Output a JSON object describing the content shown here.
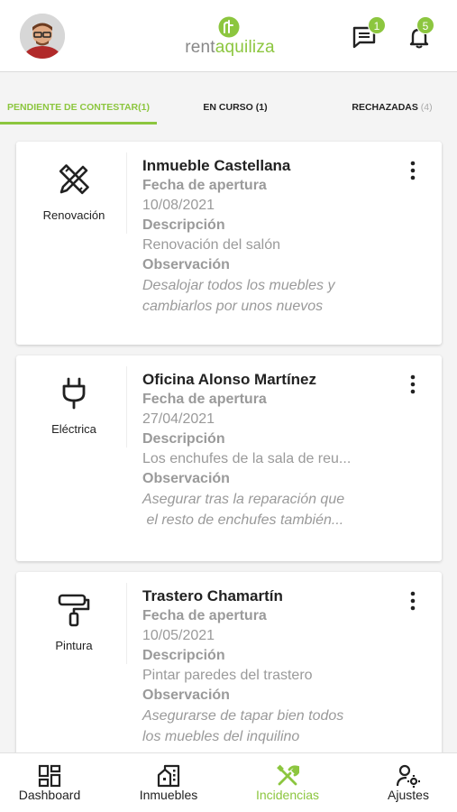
{
  "header": {
    "logo_rent": "rent",
    "logo_aqui": "aquiliza",
    "messages_badge": "1",
    "notifications_badge": "5",
    "icons": [
      "avatar",
      "chat-icon",
      "bell-icon"
    ]
  },
  "tabs": [
    {
      "label": "PENDIENTE DE CONTESTAR(1)",
      "count": ""
    },
    {
      "label": "EN CURSO (1)",
      "count": ""
    },
    {
      "label": "RECHAZADAS",
      "count": "(4)"
    }
  ],
  "cards": [
    {
      "type_label": "Renovación",
      "type_icon": "ruler-pencil-icon",
      "title": "Inmueble Castellana",
      "date_label": "Fecha de apertura",
      "date": "10/08/2021",
      "desc_label": "Descripción",
      "desc": "Renovación del salón",
      "obs_label": "Observación",
      "obs_line1": "Desalojar todos los muebles y",
      "obs_line2": "cambiarlos por unos nuevos"
    },
    {
      "type_label": "Eléctrica",
      "type_icon": "plug-icon",
      "title": "Oficina Alonso Martínez",
      "date_label": "Fecha de apertura",
      "date": "27/04/2021",
      "desc_label": "Descripción",
      "desc": "Los enchufes de la sala de reu...",
      "obs_label": "Observación",
      "obs_line1": "Asegurar tras la reparación que",
      "obs_line2": " el resto de enchufes también..."
    },
    {
      "type_label": "Pintura",
      "type_icon": "paint-roller-icon",
      "title": "Trastero Chamartín",
      "date_label": "Fecha de apertura",
      "date": "10/05/2021",
      "desc_label": "Descripción",
      "desc": "Pintar paredes del trastero",
      "obs_label": "Observación",
      "obs_line1": "Asegurarse de tapar bien todos",
      "obs_line2": "los muebles del inquilino"
    }
  ],
  "bottom_nav": [
    {
      "label": "Dashboard",
      "icon": "dashboard-icon"
    },
    {
      "label": "Inmuebles",
      "icon": "building-icon"
    },
    {
      "label": "Incidencias",
      "icon": "tools-icon"
    },
    {
      "label": "Ajustes",
      "icon": "user-settings-icon"
    }
  ],
  "colors": {
    "accent": "#8cc63f",
    "muted_text": "#9a9a9a",
    "text": "#222222"
  }
}
